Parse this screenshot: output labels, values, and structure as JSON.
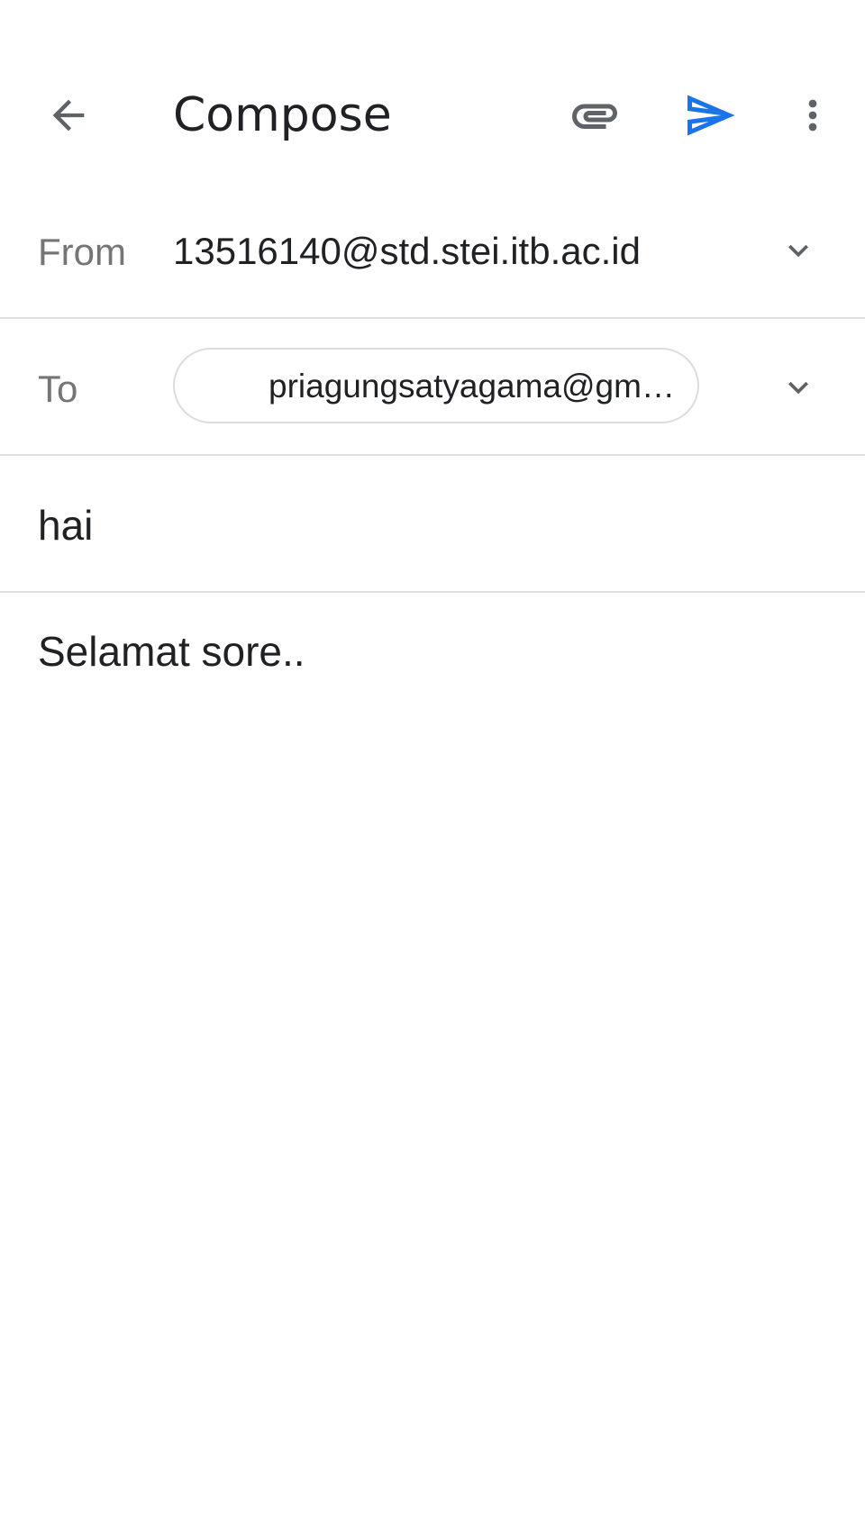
{
  "toolbar": {
    "title": "Compose",
    "back_icon": "arrow-back-icon",
    "attach_icon": "paperclip-icon",
    "send_icon": "send-icon",
    "more_icon": "more-vert-icon"
  },
  "from": {
    "label": "From",
    "value": "13516140@std.stei.itb.ac.id"
  },
  "to": {
    "label": "To",
    "recipient": "priagungsatyagama@gm…"
  },
  "subject": {
    "value": "hai"
  },
  "body": {
    "value": "Selamat sore.."
  },
  "colors": {
    "accent": "#1a73e8",
    "icon": "#5f6368",
    "divider": "#e0e0e0"
  }
}
